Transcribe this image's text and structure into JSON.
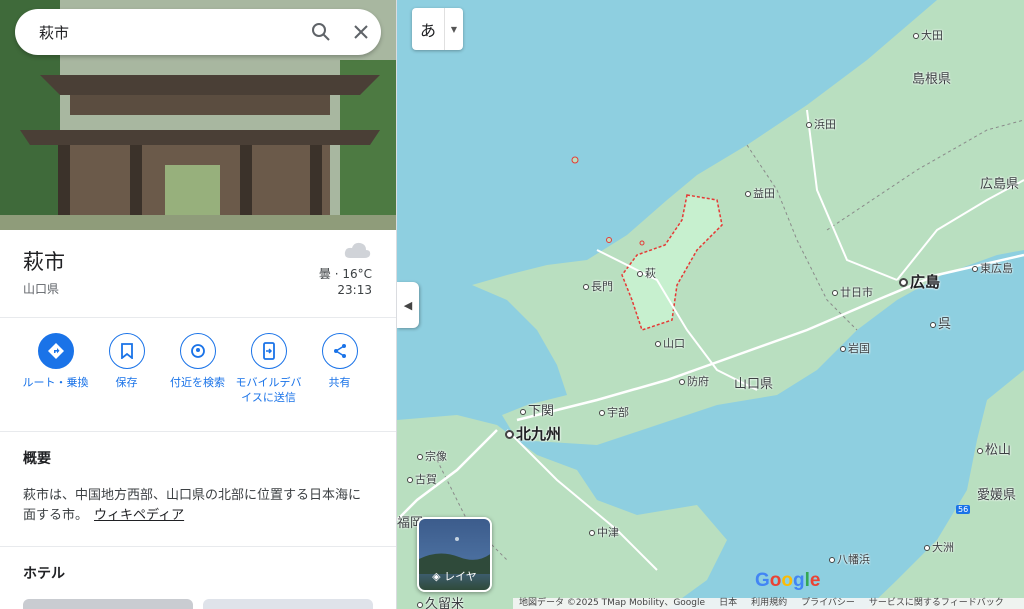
{
  "search": {
    "query": "萩市"
  },
  "place": {
    "title": "萩市",
    "subtitle": "山口県",
    "weather": "曇 · 16°C",
    "time": "23:13"
  },
  "actions": [
    {
      "label": "ルート・乗換",
      "icon": "directions-icon"
    },
    {
      "label": "保存",
      "icon": "bookmark-icon"
    },
    {
      "label": "付近を検索",
      "icon": "nearby-icon"
    },
    {
      "label": "モバイルデバイスに送信",
      "icon": "send-to-phone-icon"
    },
    {
      "label": "共有",
      "icon": "share-icon"
    }
  ],
  "overview": {
    "heading": "概要",
    "text": "萩市は、中国地方西部、山口県の北部に位置する日本海に面する市。",
    "link": "ウィキペディア"
  },
  "hotels": {
    "heading": "ホテル"
  },
  "map": {
    "ime_label": "あ",
    "layers_label": "レイヤ",
    "places": {
      "oda": "大田",
      "shimane": "島根県",
      "hamada": "浜田",
      "masuda": "益田",
      "hiroshima_pref": "広島県",
      "hagi": "萩",
      "nagato": "長門",
      "hatsukaichi": "廿日市",
      "hiroshima": "広島",
      "higashihiroshima": "東広島",
      "kure": "呉",
      "yamaguchi": "山口",
      "iwakuni": "岩国",
      "hofu": "防府",
      "yamaguchi_pref": "山口県",
      "shimonoseki": "下関",
      "ube": "宇部",
      "kitakyushu": "北九州",
      "munakata": "宗像",
      "koga": "古賀",
      "fukuoka": "福岡",
      "nakatsu": "中津",
      "kurume": "久留米",
      "matsuyama": "松山",
      "ehime": "愛媛県",
      "yawatahama": "八幡浜",
      "ozu": "大洲",
      "route": "56"
    },
    "google": "Google",
    "footer": [
      "地図データ ©2025 TMap Mobility、Google",
      "日本",
      "利用規約",
      "プライバシー",
      "サービスに関するフィードバック"
    ]
  }
}
